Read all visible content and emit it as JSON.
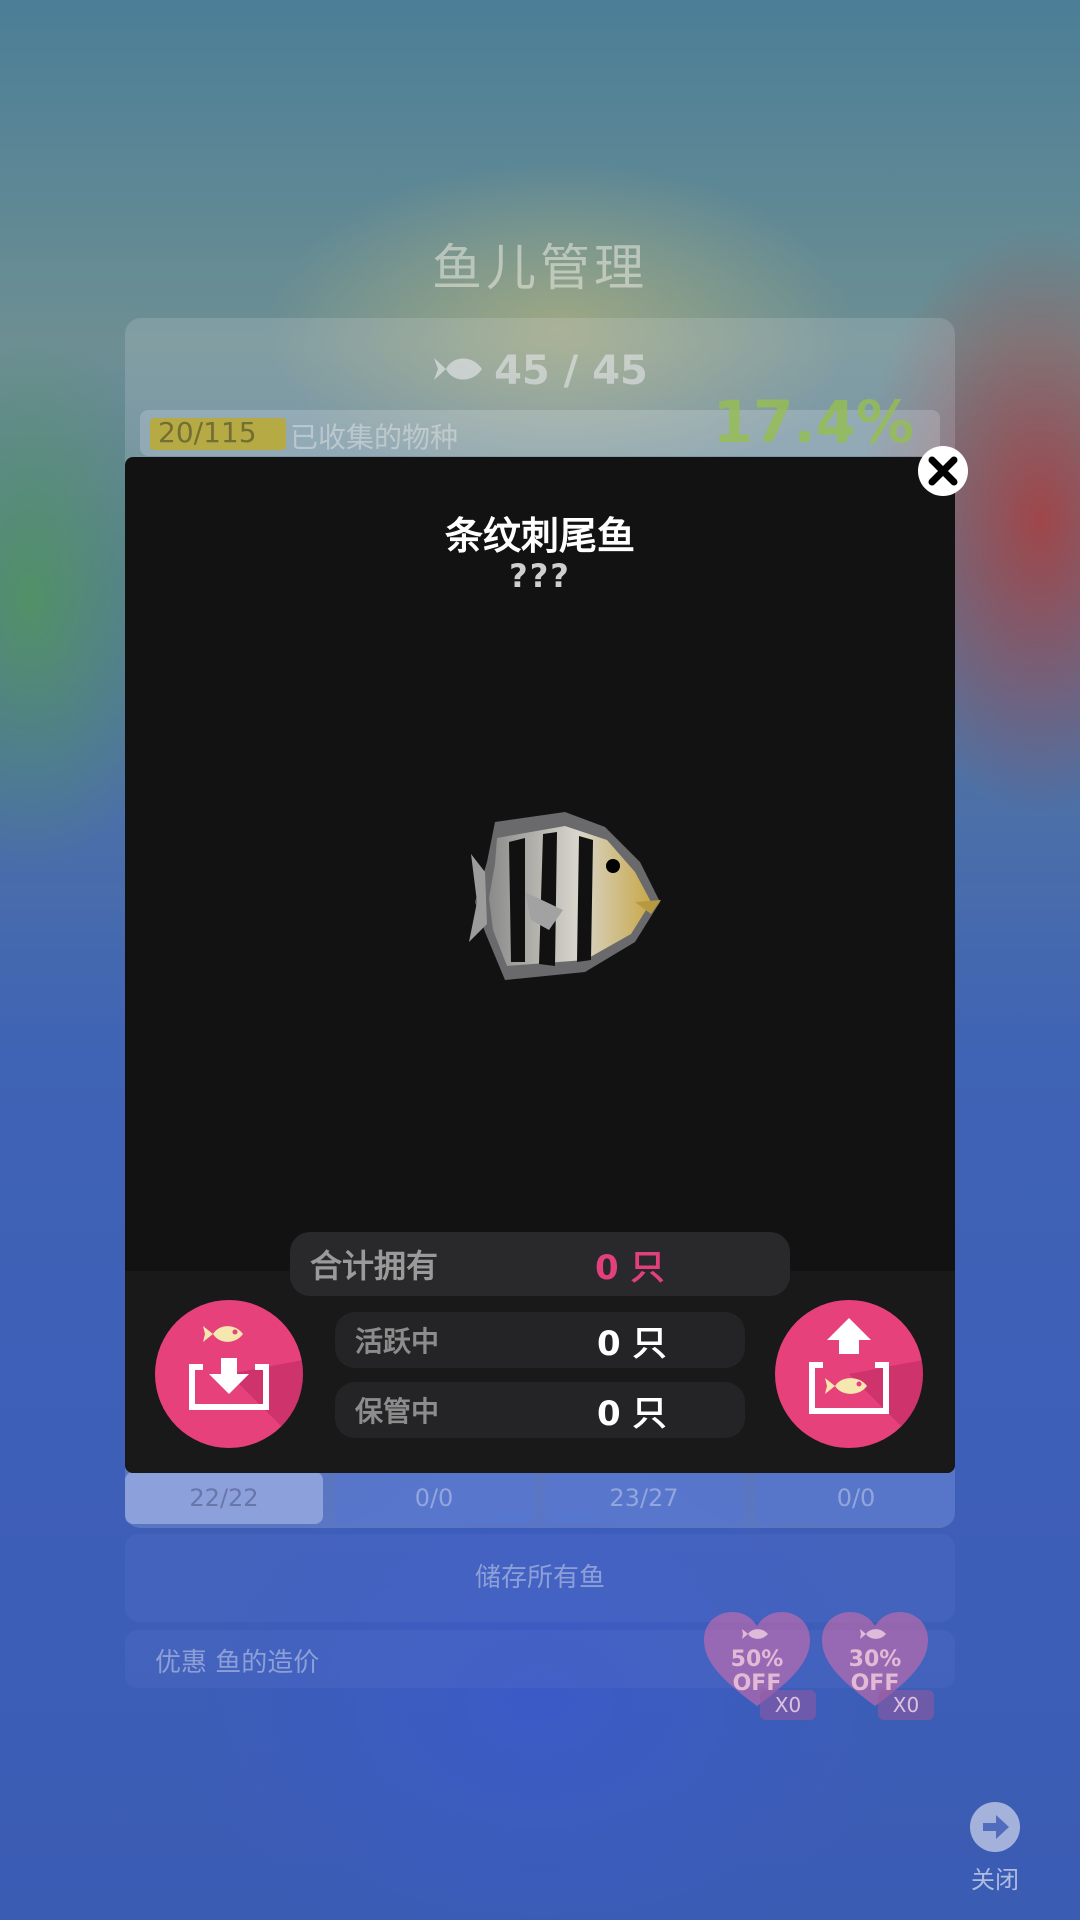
{
  "background": {
    "title": "鱼儿管理",
    "fish_count": "45 / 45",
    "progress_number": "20/115",
    "progress_label": "已收集的物种",
    "progress_fraction": 0.174,
    "percent": "17.4%",
    "tabs": [
      "22/22",
      "0/0",
      "23/27",
      "0/0"
    ],
    "store_all_label": "储存所有鱼",
    "discount_label": "优惠 鱼的造价",
    "coupons": [
      {
        "percent": "50%",
        "off": "OFF",
        "count": "X0"
      },
      {
        "percent": "30%",
        "off": "OFF",
        "count": "X0"
      }
    ],
    "close_label": "关闭"
  },
  "modal": {
    "fish_name": "条纹刺尾鱼",
    "fish_subtitle": "???",
    "stats": {
      "total_label": "合计拥有",
      "total_value": "0 只",
      "active_label": "活跃中",
      "active_value": "0 只",
      "stored_label": "保管中",
      "stored_value": "0 只"
    },
    "left_button_icon": "store-fish-icon",
    "right_button_icon": "release-fish-icon",
    "close_icon": "close-icon"
  },
  "colors": {
    "accent_pink": "#e6417a",
    "total_value_color": "#e2407a",
    "modal_bg": "#121213"
  }
}
